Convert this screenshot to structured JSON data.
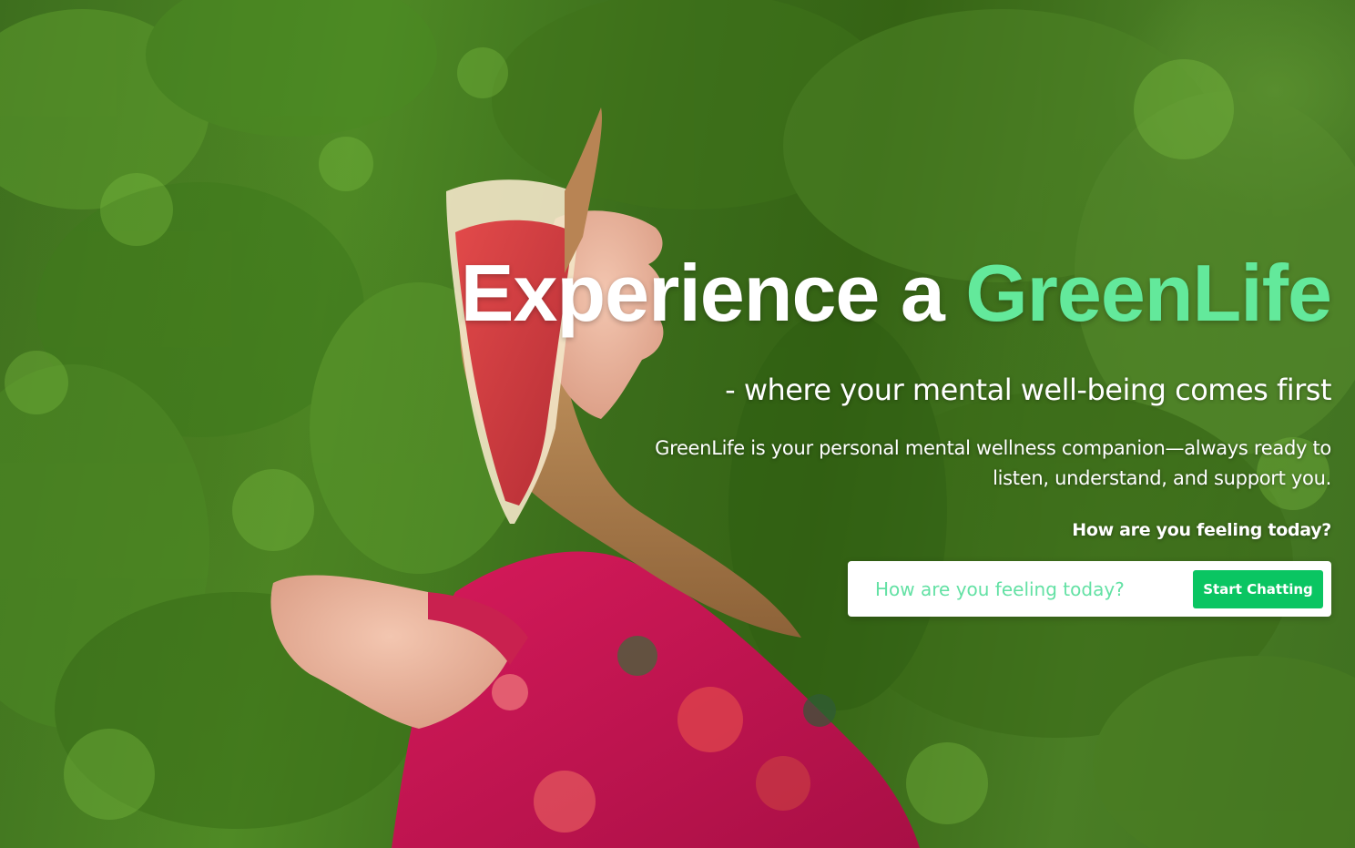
{
  "hero": {
    "headline_prefix": "Experience a ",
    "headline_accent": "GreenLife",
    "subtitle": "- where your mental well-being comes first",
    "description": "GreenLife is your personal mental wellness companion—always ready to listen, understand, and support you.",
    "prompt": "How are you feeling today?"
  },
  "chat": {
    "placeholder": "How are you feeling today?",
    "button_label": "Start Chatting"
  },
  "colors": {
    "accent": "#63e99b",
    "button": "#0ac562",
    "placeholder": "#63e1a4"
  }
}
